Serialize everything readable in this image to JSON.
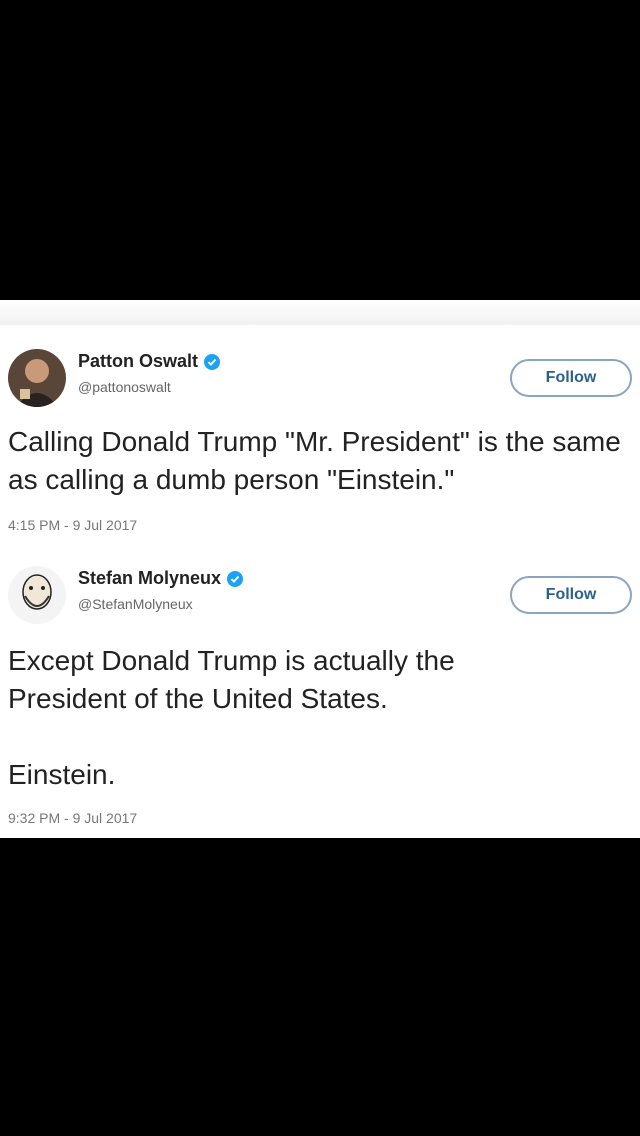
{
  "tweets": [
    {
      "name": "Patton Oswalt",
      "handle": "@pattonoswalt",
      "follow_label": "Follow",
      "text": "Calling Donald Trump \"Mr. President\" is the same as calling a dumb person \"Einstein.\"",
      "timestamp": "4:15 PM - 9 Jul 2017"
    },
    {
      "name": "Stefan Molyneux",
      "handle": "@StefanMolyneux",
      "follow_label": "Follow",
      "text": "Except Donald Trump is actually the\nPresident of the United States.\n\nEinstein.",
      "timestamp": "9:32 PM - 9 Jul 2017"
    }
  ],
  "colors": {
    "verified": "#1da1f2",
    "follow_border": "#8aa5bf",
    "follow_text": "#2d5f8f",
    "background": "#000000"
  },
  "icons": {
    "verified": "verified-badge-icon"
  }
}
